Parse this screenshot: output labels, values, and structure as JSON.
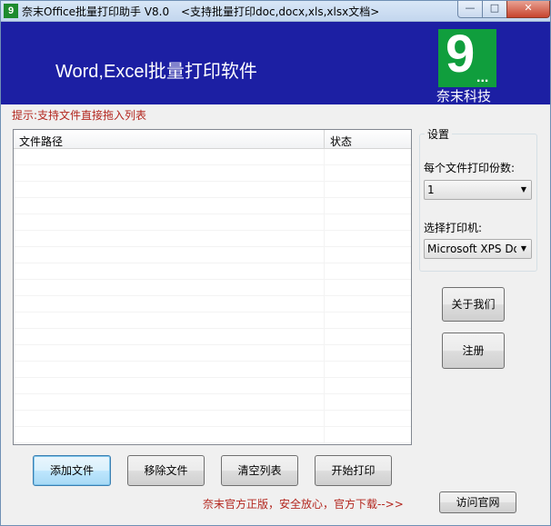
{
  "window": {
    "title": "奈末Office批量打印助手 V8.0",
    "subtitle": "<支持批量打印doc,docx,xls,xlsx文档>",
    "app_icon_glyph": "9",
    "controls": {
      "minimize": "—",
      "maximize": "□",
      "close": "✕"
    }
  },
  "banner": {
    "title": "Word,Excel批量打印软件",
    "logo_glyph": "9",
    "logo_dots": "...",
    "logo_caption": "奈末科技",
    "background_color": "#1c1fa3",
    "logo_color": "#109e3d"
  },
  "hint": "提示:支持文件直接拖入列表",
  "file_list": {
    "columns": [
      "文件路径",
      "状态"
    ],
    "rows": []
  },
  "settings": {
    "group_title": "设置",
    "copies_label": "每个文件打印份数:",
    "copies_value": "1",
    "printer_label": "选择打印机:",
    "printer_value": "Microsoft XPS Doc"
  },
  "buttons": {
    "about": "关于我们",
    "register": "注册",
    "add_file": "添加文件",
    "remove_file": "移除文件",
    "clear_list": "清空列表",
    "start_print": "开始打印",
    "visit_site": "访问官网"
  },
  "promo": "奈末官方正版，安全放心，官方下载-->>"
}
